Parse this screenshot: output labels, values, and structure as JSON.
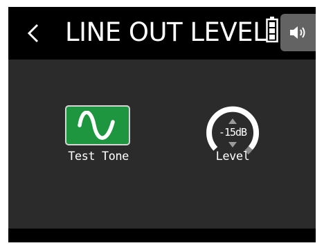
{
  "header": {
    "back_icon": "chevron-left-icon",
    "title": "LINE OUT LEVEL",
    "battery_icon": "battery-icon",
    "speaker_icon": "speaker-icon"
  },
  "test_tone": {
    "icon": "sine-wave-icon",
    "label": "Test Tone",
    "color": "#1e9640",
    "active": true
  },
  "level": {
    "value": "-15dB",
    "label": "Level",
    "icons": [
      "up-arrow-icon",
      "down-arrow-icon"
    ]
  }
}
